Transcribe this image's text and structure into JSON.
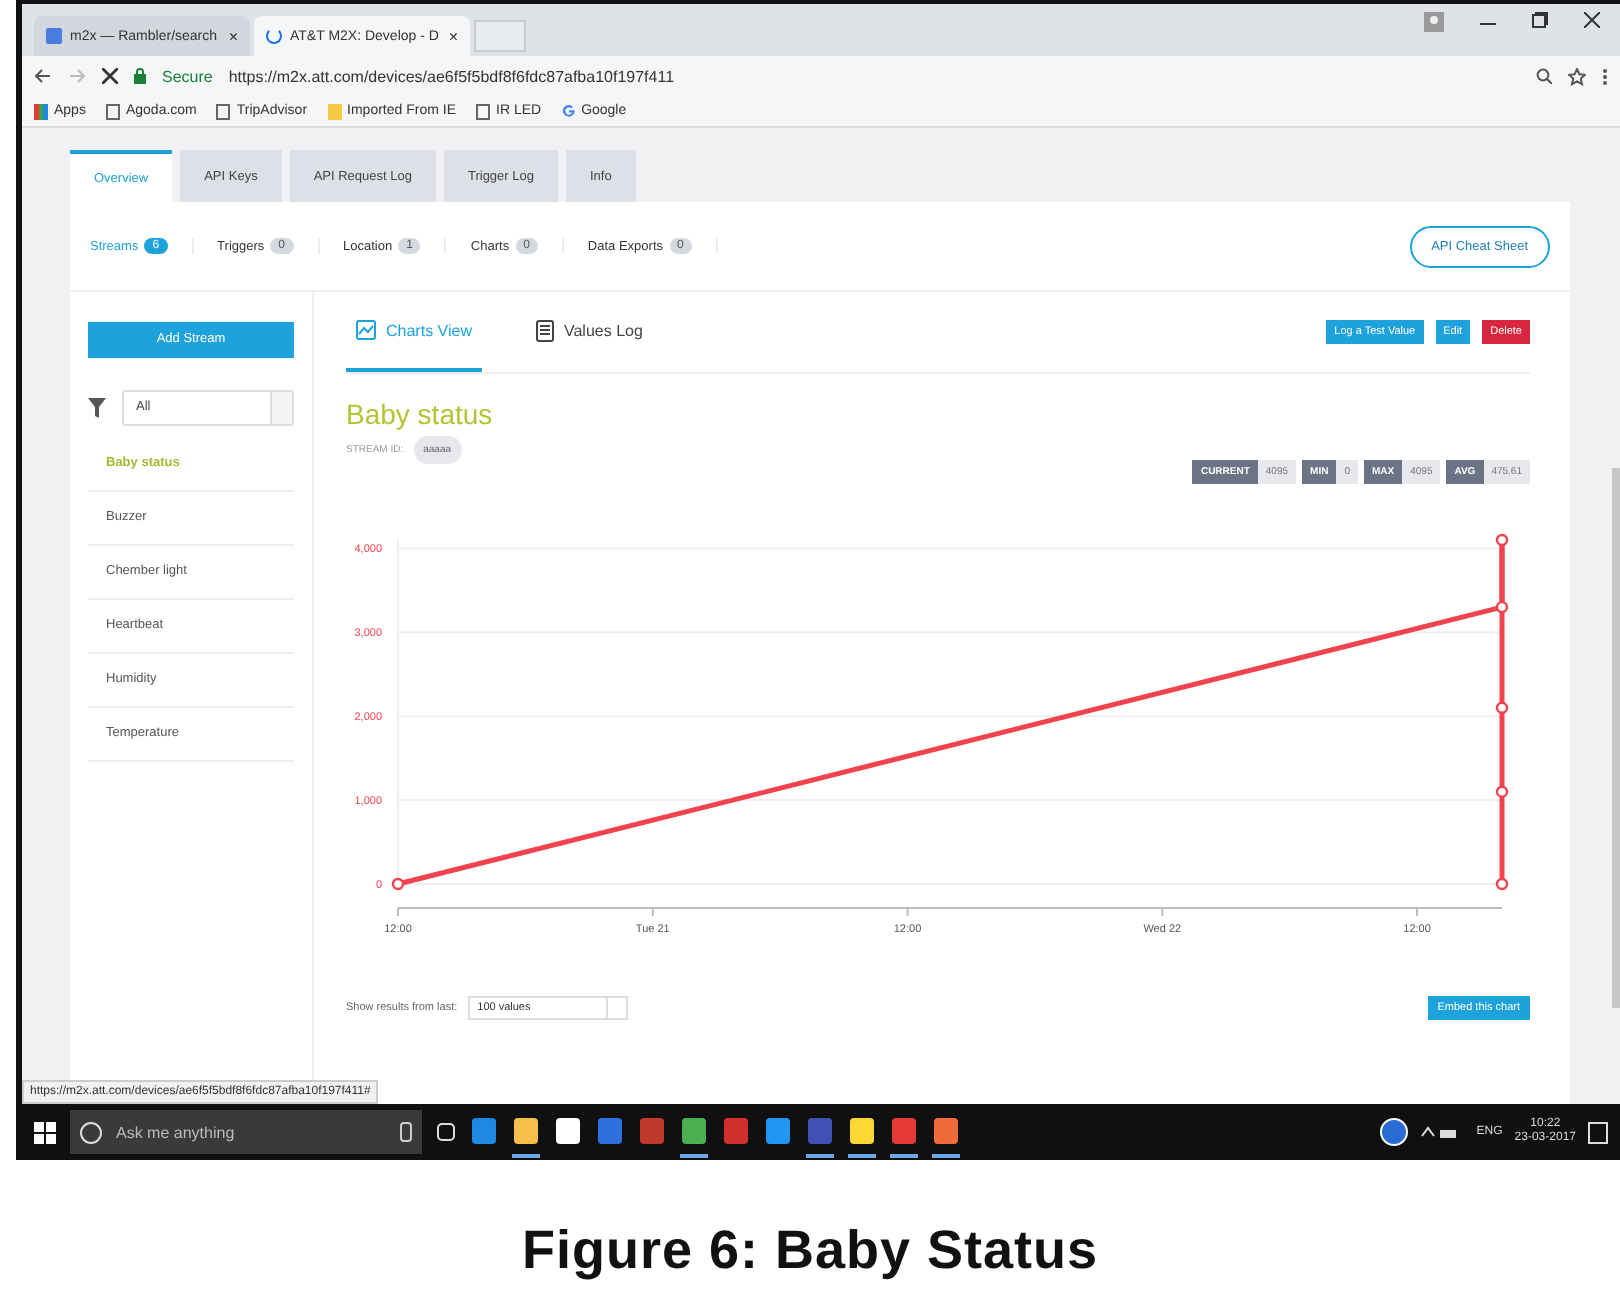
{
  "browser": {
    "tabs": [
      {
        "title": "m2x — Rambler/search",
        "close": "×",
        "selected": false
      },
      {
        "title": "AT&T M2X: Develop - D",
        "close": "×",
        "selected": true
      }
    ],
    "secure": "Secure",
    "url": "https://m2x.att.com/devices/ae6f5f5bdf8f6fdc87afba10f197f411",
    "bookmarks": [
      {
        "label": "Apps",
        "kind": "apps"
      },
      {
        "label": "Agoda.com",
        "kind": "page"
      },
      {
        "label": "TripAdvisor",
        "kind": "page"
      },
      {
        "label": "Imported From IE",
        "kind": "folder"
      },
      {
        "label": "IR LED",
        "kind": "page"
      },
      {
        "label": "Google",
        "kind": "google"
      }
    ]
  },
  "page_tabs": [
    {
      "label": "Overview",
      "selected": true
    },
    {
      "label": "API Keys",
      "selected": false
    },
    {
      "label": "API Request Log",
      "selected": false
    },
    {
      "label": "Trigger Log",
      "selected": false
    },
    {
      "label": "Info",
      "selected": false
    }
  ],
  "sections": [
    {
      "label": "Streams",
      "count": "6",
      "selected": true
    },
    {
      "label": "Triggers",
      "count": "0",
      "selected": false
    },
    {
      "label": "Location",
      "count": "1",
      "selected": false
    },
    {
      "label": "Charts",
      "count": "0",
      "selected": false
    },
    {
      "label": "Data Exports",
      "count": "0",
      "selected": false
    }
  ],
  "cheat_sheet": "API Cheat Sheet",
  "add_stream": "Add Stream",
  "filter": {
    "value": "All"
  },
  "streams": [
    {
      "name": "Baby status",
      "selected": true
    },
    {
      "name": "Buzzer",
      "selected": false
    },
    {
      "name": "Chember light",
      "selected": false
    },
    {
      "name": "Heartbeat",
      "selected": false
    },
    {
      "name": "Humidity",
      "selected": false
    },
    {
      "name": "Temperature",
      "selected": false
    }
  ],
  "view_tabs": [
    {
      "label": "Charts View",
      "kind": "chart",
      "selected": true
    },
    {
      "label": "Values Log",
      "kind": "log",
      "selected": false
    }
  ],
  "actions": [
    {
      "label": "Log a Test Value",
      "kind": "primary"
    },
    {
      "label": "Edit",
      "kind": "primary"
    },
    {
      "label": "Delete",
      "kind": "danger"
    }
  ],
  "stream": {
    "title": "Baby status",
    "id_label": "STREAM ID:",
    "id": "aaaaa"
  },
  "stats": [
    {
      "label": "CURRENT",
      "value": "4095"
    },
    {
      "label": "MIN",
      "value": "0"
    },
    {
      "label": "MAX",
      "value": "4095"
    },
    {
      "label": "AVG",
      "value": "475.61"
    }
  ],
  "chart_data": {
    "type": "line",
    "categories": [
      "12:00",
      null,
      null,
      "Tue 21",
      null,
      null,
      "12:00",
      null,
      null,
      "Wed 22",
      null,
      null,
      "12:00",
      null
    ],
    "grid": true,
    "ylim": [
      0,
      4100
    ],
    "series": [
      {
        "color": "#f0434f",
        "marker": true,
        "values": [
          0,
          null,
          null,
          null,
          null,
          null,
          null,
          null,
          null,
          null,
          null,
          null,
          null,
          3300
        ]
      },
      {
        "color": "#f0434f",
        "marker": true,
        "values": [
          null,
          null,
          null,
          null,
          null,
          null,
          null,
          null,
          null,
          null,
          null,
          null,
          null,
          4100
        ]
      },
      {
        "color": "#f0434f",
        "marker": true,
        "values": [
          null,
          null,
          null,
          null,
          null,
          null,
          null,
          null,
          null,
          null,
          null,
          null,
          null,
          2100
        ]
      },
      {
        "color": "#f0434f",
        "marker": true,
        "values": [
          null,
          null,
          null,
          null,
          null,
          null,
          null,
          null,
          null,
          null,
          null,
          null,
          null,
          1100
        ]
      },
      {
        "color": "#f0434f",
        "marker": true,
        "values": [
          null,
          null,
          null,
          null,
          null,
          null,
          null,
          null,
          null,
          null,
          null,
          null,
          null,
          0
        ]
      }
    ],
    "yticks": [
      {
        "value": 0,
        "label": "0"
      },
      {
        "value": 1000,
        "label": "1,000"
      },
      {
        "value": 2000,
        "label": "2,000"
      },
      {
        "value": 3000,
        "label": "3,000"
      },
      {
        "value": 4000,
        "label": "4,000"
      }
    ]
  },
  "show_results": {
    "label": "Show results from last:",
    "value": "100 values"
  },
  "embed": "Embed this chart",
  "status_url": "https://m2x.att.com/devices/ae6f5f5bdf8f6fdc87afba10f197f411#",
  "taskbar": {
    "search_placeholder": "Ask me anything",
    "apps": [
      {
        "color": "#1e88e5",
        "selected": false
      },
      {
        "color": "#f5c04a",
        "selected": true
      },
      {
        "color": "#ffffff",
        "selected": false
      },
      {
        "color": "#2f6fde",
        "selected": false
      },
      {
        "color": "#c0392b",
        "selected": false
      },
      {
        "color": "#4caf50",
        "selected": true
      },
      {
        "color": "#d32f2f",
        "selected": false
      },
      {
        "color": "#2196f3",
        "selected": false
      },
      {
        "color": "#3f51b5",
        "selected": true
      },
      {
        "color": "#fdd835",
        "selected": true
      },
      {
        "color": "#e53935",
        "selected": true
      },
      {
        "color": "#ef6c3a",
        "selected": true
      }
    ],
    "language": "ENG",
    "time": "10:22",
    "date": "23-03-2017"
  },
  "caption": "Figure 6:  Baby Status"
}
